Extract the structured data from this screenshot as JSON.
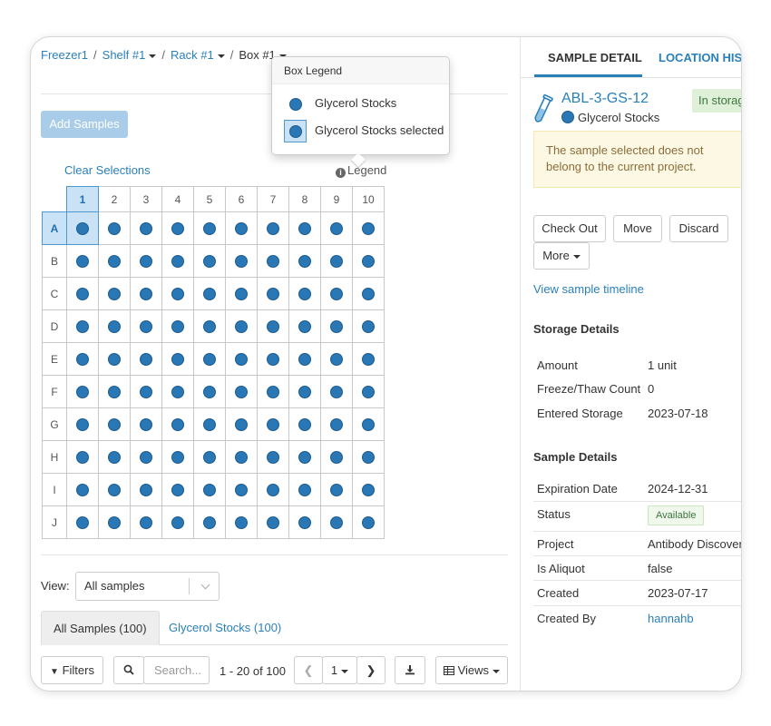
{
  "breadcrumb": {
    "freezer": "Freezer1",
    "shelf": "Shelf #1",
    "rack": "Rack #1",
    "box": "Box #1",
    "separator": "/"
  },
  "add_samples_label": "Add Samples",
  "clear_selections_label": "Clear Selections",
  "legend_link_label": "Legend",
  "legend_popover": {
    "title": "Box Legend",
    "items": [
      "Glycerol Stocks",
      "Glycerol Stocks selected"
    ]
  },
  "grid": {
    "columns": [
      "1",
      "2",
      "3",
      "4",
      "5",
      "6",
      "7",
      "8",
      "9",
      "10"
    ],
    "rows": [
      "A",
      "B",
      "C",
      "D",
      "E",
      "F",
      "G",
      "H",
      "I",
      "J"
    ],
    "selected": "A1",
    "sample_color": "#2a77b5",
    "selected_bg": "#c9e2f5"
  },
  "view": {
    "label": "View:",
    "selected": "All samples"
  },
  "tabs": [
    "All Samples (100)",
    "Glycerol Stocks (100)"
  ],
  "toolbar": {
    "filters_label": "Filters",
    "search_placeholder": "Search...",
    "paging_text": "1 - 20 of 100",
    "page_number": "1",
    "views_label": "Views"
  },
  "detail": {
    "tabs": [
      "SAMPLE DETAIL",
      "LOCATION HISTORY"
    ],
    "sample_name": "ABL-3-GS-12",
    "sample_type": "Glycerol Stocks",
    "status_pill": "In storage",
    "warning": "The sample selected does not belong to the current project.",
    "buttons": {
      "check_out": "Check Out",
      "move": "Move",
      "discard": "Discard",
      "more": "More"
    },
    "timeline_link": "View sample timeline",
    "storage_title": "Storage Details",
    "storage": [
      {
        "key": "Amount",
        "value": "1 unit"
      },
      {
        "key": "Freeze/Thaw Count",
        "value": "0"
      },
      {
        "key": "Entered Storage",
        "value": "2023-07-18"
      }
    ],
    "sample_title": "Sample Details",
    "sample_details": [
      {
        "key": "Expiration Date",
        "value": "2024-12-31"
      },
      {
        "key": "Status",
        "value": "Available"
      },
      {
        "key": "Project",
        "value": "Antibody Discovery"
      },
      {
        "key": "Is Aliquot",
        "value": "false"
      },
      {
        "key": "Created",
        "value": "2023-07-17"
      },
      {
        "key": "Created By",
        "value": "hannahb"
      }
    ]
  }
}
